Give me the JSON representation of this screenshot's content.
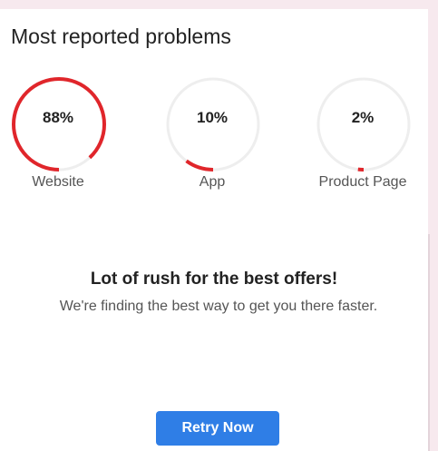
{
  "panel": {
    "title": "Most reported problems"
  },
  "gauges": [
    {
      "value": 88,
      "label_text": "88%",
      "name": "Website"
    },
    {
      "value": 10,
      "label_text": "10%",
      "name": "App"
    },
    {
      "value": 2,
      "label_text": "2%",
      "name": "Product Page"
    }
  ],
  "message": {
    "headline": "Lot of rush for the best offers!",
    "subtext": "We're finding the best way to get you there faster."
  },
  "actions": {
    "retry_label": "Retry Now"
  },
  "colors": {
    "accent_arc": "#e0262b",
    "track": "#eeeeee",
    "button": "#2f7ee6",
    "backdrop": "#f7e9ee"
  }
}
